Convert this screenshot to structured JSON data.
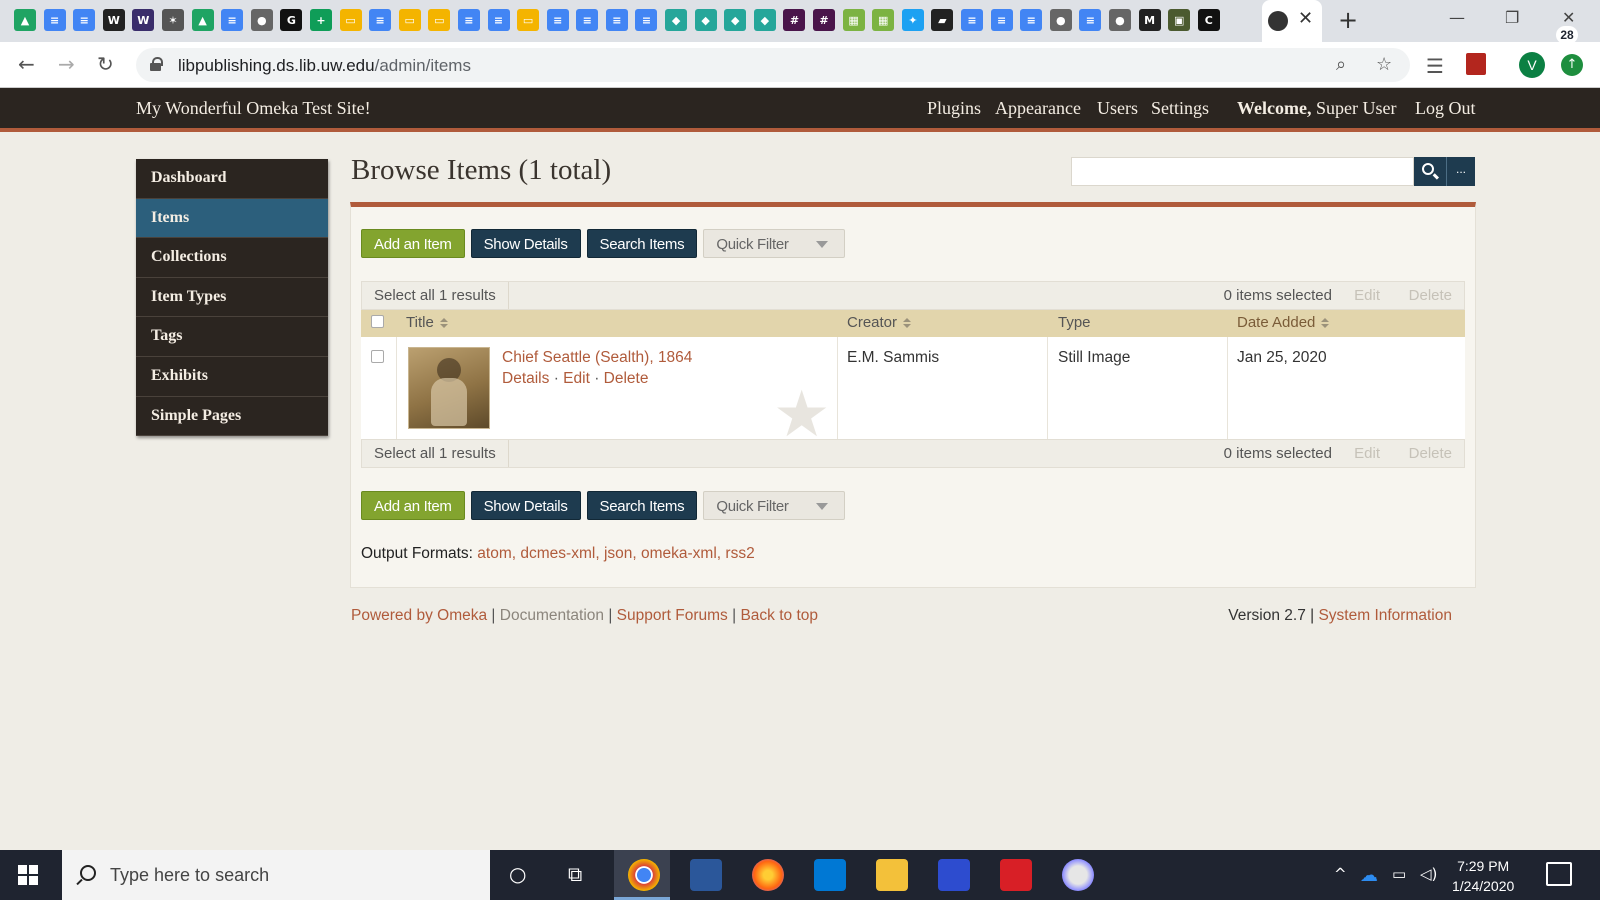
{
  "browser": {
    "url_host": "libpublishing.ds.lib.uw.edu",
    "url_path": "/admin/items",
    "profile_initial": "V"
  },
  "header": {
    "site_title": "My Wonderful Omeka Test Site!",
    "nav": [
      "Plugins",
      "Appearance",
      "Users",
      "Settings"
    ],
    "welcome": "Welcome,",
    "user": "Super User",
    "logout": "Log Out"
  },
  "sidebar": {
    "items": [
      {
        "label": "Dashboard"
      },
      {
        "label": "Items"
      },
      {
        "label": "Collections"
      },
      {
        "label": "Item Types"
      },
      {
        "label": "Tags"
      },
      {
        "label": "Exhibits"
      },
      {
        "label": "Simple Pages"
      }
    ]
  },
  "main": {
    "title": "Browse Items (1 total)",
    "search_more": "...",
    "buttons": {
      "add": "Add an Item",
      "details": "Show Details",
      "search": "Search Items",
      "quick_filter": "Quick Filter"
    },
    "batch": {
      "select_all": "Select all 1 results",
      "selected": "0 items selected",
      "edit": "Edit",
      "delete": "Delete"
    },
    "table": {
      "headers": {
        "title": "Title",
        "creator": "Creator",
        "type": "Type",
        "date_added": "Date Added"
      },
      "rows": [
        {
          "title": "Chief Seattle (Sealth), 1864",
          "actions": {
            "details": "Details",
            "edit": "Edit",
            "delete": "Delete"
          },
          "creator": "E.M. Sammis",
          "type": "Still Image",
          "date_added": "Jan 25, 2020"
        }
      ]
    },
    "output_formats": {
      "label": "Output Formats:",
      "formats": [
        "atom",
        "dcmes-xml",
        "json",
        "omeka-xml",
        "rss2"
      ]
    }
  },
  "footer": {
    "powered": "Powered by Omeka",
    "docs": "Documentation",
    "forums": "Support Forums",
    "top": "Back to top",
    "version": "Version 2.7",
    "sysinfo": "System Information"
  },
  "taskbar": {
    "search_placeholder": "Type here to search",
    "time": "7:29 PM",
    "date": "1/24/2020",
    "notifications": "28"
  },
  "colors": {
    "accent": "#b05b3b",
    "header_bg": "#2b2520",
    "active_nav": "#2c5f7c",
    "button_green": "#83a42f",
    "button_dark": "#1e3b4f"
  }
}
